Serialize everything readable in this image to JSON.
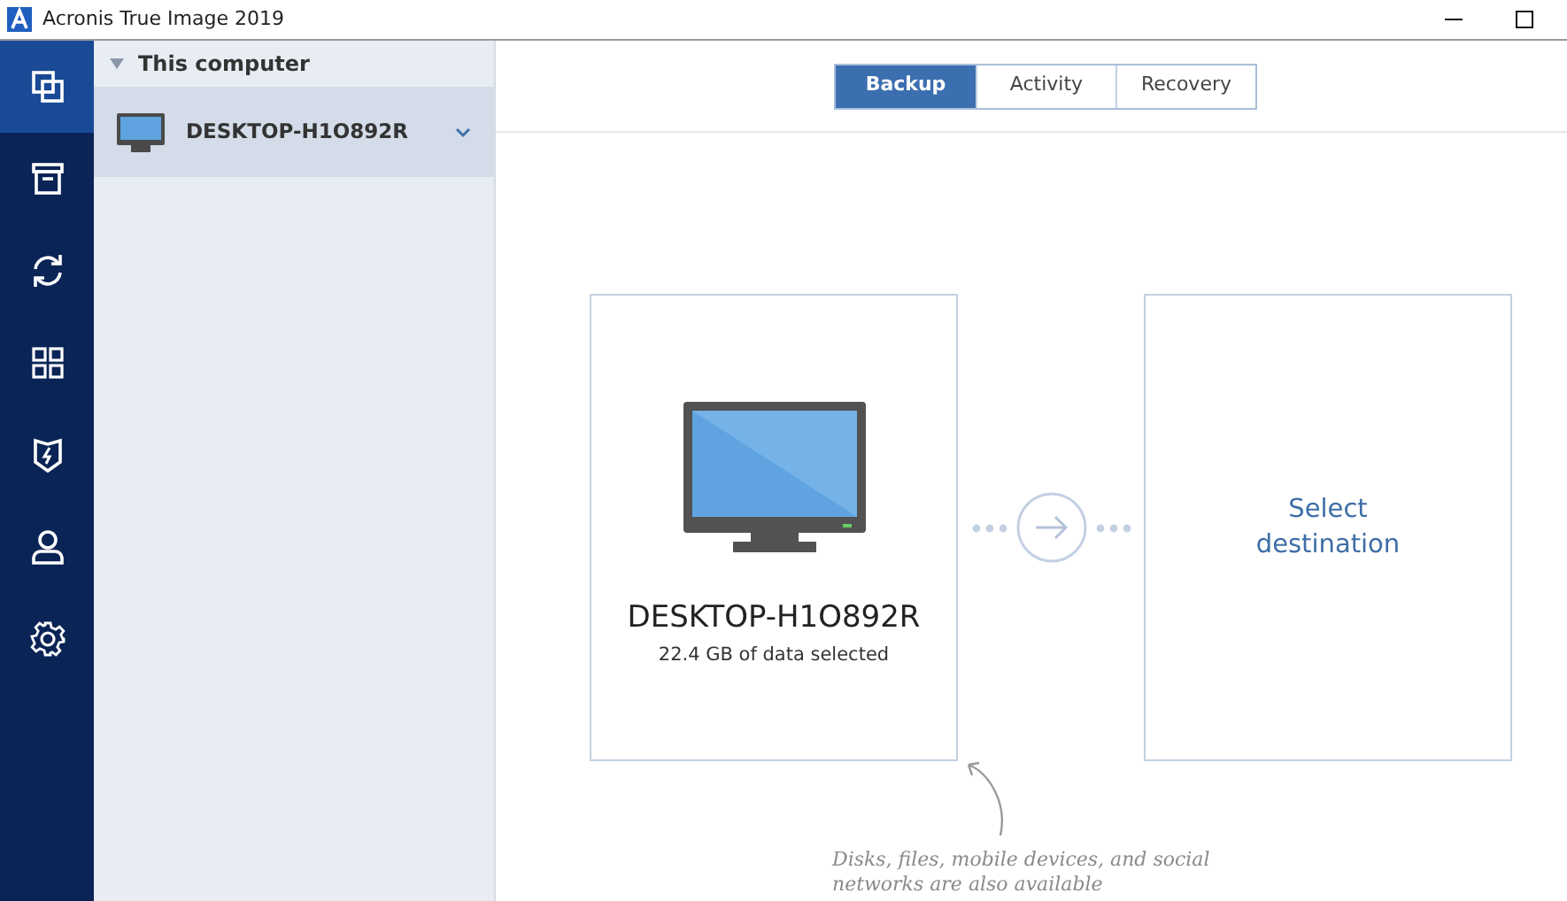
{
  "window": {
    "title": "Acronis True Image 2019"
  },
  "nav": [
    {
      "selected": true
    },
    {
      "selected": false
    },
    {
      "selected": false
    },
    {
      "selected": false
    },
    {
      "selected": false
    },
    {
      "selected": false
    },
    {
      "selected": false
    }
  ],
  "sources": {
    "group": "This computer",
    "expanded": true,
    "items": [
      {
        "name": "DESKTOP-H1O892R",
        "selected": true
      }
    ]
  },
  "tabs": [
    {
      "label": "Backup",
      "selected": true
    },
    {
      "label": "Activity",
      "selected": false
    },
    {
      "label": "Recovery",
      "selected": false
    }
  ],
  "source_card": {
    "name": "DESKTOP-H1O892R",
    "detail": "22.4 GB of data selected"
  },
  "destination_card": {
    "label": "Select destination"
  },
  "hint": "Disks, files, mobile devices, and social networks are also available"
}
